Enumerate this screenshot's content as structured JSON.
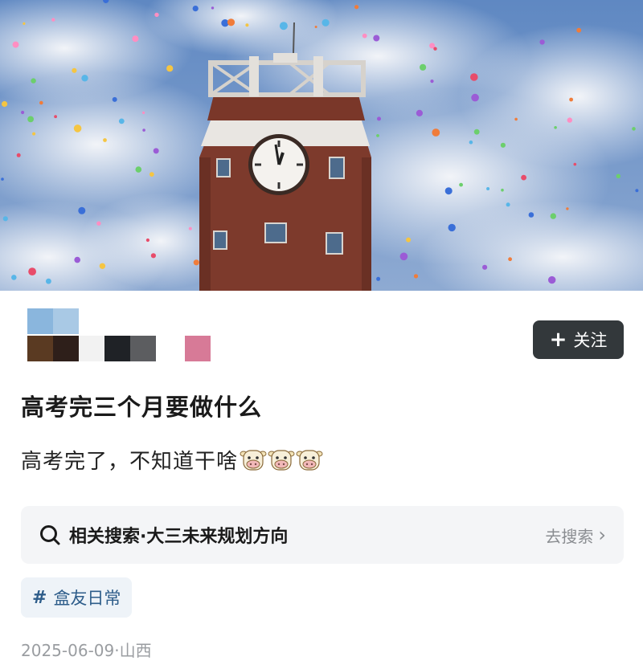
{
  "post": {
    "follow_label": "关注",
    "follow_icon": "plus-icon",
    "title": "高考完三个月要做什么",
    "body": "高考完了，不知道干啥",
    "emoji_icon": "cow-face-emoji",
    "emoji_count": 3
  },
  "related_search": {
    "icon": "search-icon",
    "label": "相关搜索·大三未来规划方向",
    "action": "去搜索",
    "action_icon": "chevron-right-icon"
  },
  "tag": {
    "icon": "hash-icon",
    "label": "盒友日常"
  },
  "meta": {
    "date_location": "2025-06-09·山西"
  },
  "colors": {
    "follow_bg": "#33383b",
    "tag_text": "#2e5d8a",
    "search_bg": "#f4f5f7",
    "meta_text": "#9a9da1"
  }
}
